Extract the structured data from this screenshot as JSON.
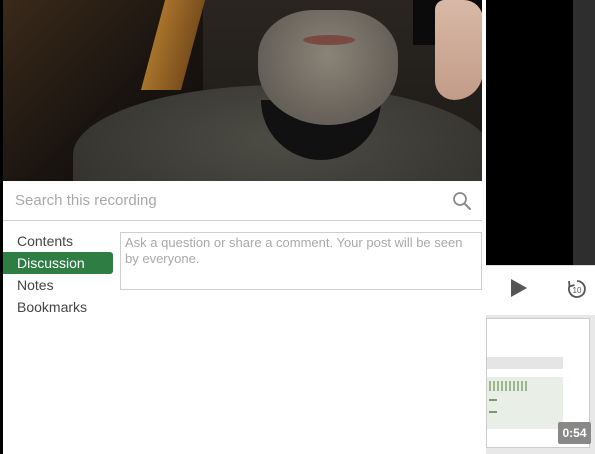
{
  "search": {
    "placeholder": "Search this recording"
  },
  "nav": {
    "items": [
      {
        "label": "Contents",
        "active": false
      },
      {
        "label": "Discussion",
        "active": true
      },
      {
        "label": "Notes",
        "active": false
      },
      {
        "label": "Bookmarks",
        "active": false
      }
    ]
  },
  "discussion": {
    "placeholder": "Ask a question or share a comment. Your post will be seen by everyone."
  },
  "player": {
    "rewind_seconds": "10",
    "thumbnail_time": "0:54"
  },
  "colors": {
    "accent": "#2e7d43"
  },
  "icons": {
    "search": "search-icon",
    "play": "play-icon",
    "rewind": "rewind-10-icon"
  }
}
